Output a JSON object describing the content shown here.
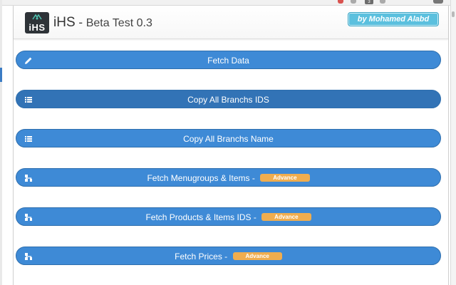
{
  "header": {
    "logo_text": "iHS",
    "app_name": "iHS",
    "separator": " - ",
    "subtitle": "Beta Test 0.3",
    "author_badge": "by Mohamed Alabd"
  },
  "browser": {
    "badge_count": "3"
  },
  "actions": [
    {
      "label": "Fetch Data",
      "icon": "pencil-icon",
      "advance": ""
    },
    {
      "label": "Copy All Branchs IDS",
      "icon": "list-icon",
      "advance": ""
    },
    {
      "label": "Copy All Branchs Name",
      "icon": "list-icon",
      "advance": ""
    },
    {
      "label": "Fetch Menugroups & Items - ",
      "icon": "sitemap-icon",
      "advance": "Advance"
    },
    {
      "label": "Fetch Products & Items IDS - ",
      "icon": "sitemap-icon",
      "advance": "Advance"
    },
    {
      "label": "Fetch Prices - ",
      "icon": "sitemap-icon",
      "advance": "Advance"
    }
  ],
  "colors": {
    "button": "#3e8ad6",
    "button_active": "#3273b6",
    "badge_author": "#5bc0de",
    "badge_advance": "#f0ad4e"
  }
}
